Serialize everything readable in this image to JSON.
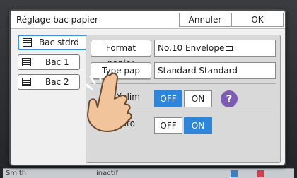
{
  "dialog": {
    "title": "Réglage bac papier",
    "cancel_label": "Annuler",
    "ok_label": "OK"
  },
  "trays": [
    {
      "label": "Bac stdrd",
      "selected": true
    },
    {
      "label": "Bac 1",
      "selected": false
    },
    {
      "label": "Bac 2",
      "selected": false
    }
  ],
  "settings": {
    "format_label": "Format papier",
    "format_value": "No.10 Envelope",
    "type_label": "Type pap",
    "type_value": "Standard Standard",
    "xalim_label": "Xalim",
    "xalim_off": "OFF",
    "xalim_on": "ON",
    "xalim_state": "OFF",
    "auto_label": "auto",
    "auto_off": "OFF",
    "auto_on": "ON",
    "auto_state": "ON",
    "help_label": "?"
  },
  "background": {
    "left_text": "Smith",
    "mid_text": "inactif"
  },
  "colors": {
    "accent": "#2f86d9",
    "help": "#7b5bb3",
    "selected_border": "#3d8fd6"
  },
  "icons": [
    "tray-icon",
    "envelope-icon",
    "help-icon",
    "pointing-hand-icon"
  ]
}
